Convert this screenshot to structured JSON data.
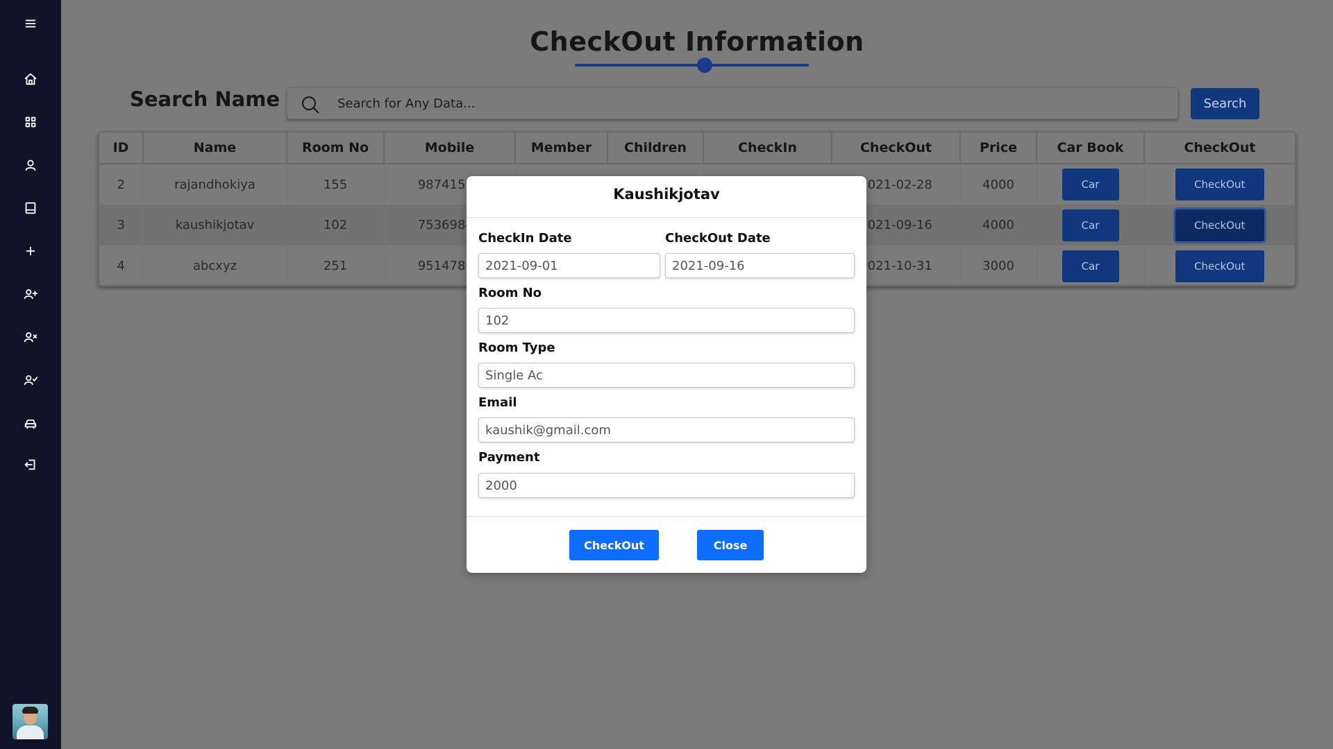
{
  "page": {
    "title": "CheckOut Information",
    "search_label": "Search Name",
    "search_placeholder": "Search for Any Data...",
    "search_button": "Search"
  },
  "sidebar": {
    "items": [
      {
        "icon": "menu-icon"
      },
      {
        "icon": "home-icon"
      },
      {
        "icon": "grid-icon"
      },
      {
        "icon": "user-icon"
      },
      {
        "icon": "book-icon"
      },
      {
        "icon": "plus-icon"
      },
      {
        "icon": "user-plus-icon"
      },
      {
        "icon": "user-x-icon"
      },
      {
        "icon": "user-check-icon"
      },
      {
        "icon": "car-icon"
      },
      {
        "icon": "logout-icon"
      }
    ]
  },
  "table": {
    "headers": [
      "ID",
      "Name",
      "Room No",
      "Mobile",
      "Member",
      "Children",
      "CheckIn",
      "CheckOut",
      "Price",
      "Car Book",
      "CheckOut"
    ],
    "rows": [
      {
        "id": "2",
        "name": "rajandhokiya",
        "room": "155",
        "mobile": "98741521",
        "checkout": "2021-02-28",
        "price": "4000",
        "car": "Car",
        "action": "CheckOut"
      },
      {
        "id": "3",
        "name": "kaushikjotav",
        "room": "102",
        "mobile": "75369847",
        "checkout": "2021-09-16",
        "price": "4000",
        "car": "Car",
        "action": "CheckOut"
      },
      {
        "id": "4",
        "name": "abcxyz",
        "room": "251",
        "mobile": "95147862",
        "checkout": "2021-10-31",
        "price": "3000",
        "car": "Car",
        "action": "CheckOut"
      }
    ]
  },
  "modal": {
    "title": "Kaushikjotav",
    "checkin_label": "CheckIn Date",
    "checkin_value": "2021-09-01",
    "checkout_label": "CheckOut Date",
    "checkout_value": "2021-09-16",
    "room_no_label": "Room No",
    "room_no_value": "102",
    "room_type_label": "Room Type",
    "room_type_value": "Single Ac",
    "email_label": "Email",
    "email_value": "kaushik@gmail.com",
    "payment_label": "Payment",
    "payment_value": "2000",
    "checkout_button": "CheckOut",
    "close_button": "Close"
  },
  "colors": {
    "sidebar": "#12122a",
    "overlay": "#7b7b7b",
    "dark_button": "#11387e",
    "primary_button": "#0d6efd"
  }
}
